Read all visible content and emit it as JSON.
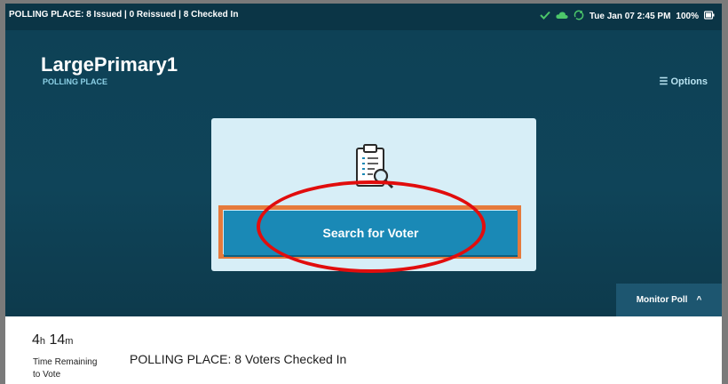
{
  "status_bar": {
    "left_text": "POLLING PLACE: 8 Issued | 0 Reissued | 8 Checked In",
    "datetime": "Tue Jan 07  2:45 PM",
    "battery": "100%",
    "icons": [
      "check-icon",
      "cloud-icon",
      "sync-icon",
      "battery-icon"
    ]
  },
  "header": {
    "place_name": "LargePrimary1",
    "place_type": "POLLING PLACE",
    "options_label": "☰ Options"
  },
  "card": {
    "icon": "clipboard-search-icon",
    "button_label": "Search for Voter"
  },
  "monitor": {
    "label": "Monitor Poll",
    "chevron": "^"
  },
  "footer": {
    "hours": "4",
    "hours_unit": "h",
    "minutes": "14",
    "minutes_unit": "m",
    "time_label": "Time Remaining to Vote",
    "checked_in_text": "POLLING PLACE: 8 Voters Checked In"
  },
  "colors": {
    "background": "#0e4156",
    "button": "#1a89b6",
    "highlight_box": "#e57a3c",
    "annotation_oval": "#e10d0d"
  }
}
